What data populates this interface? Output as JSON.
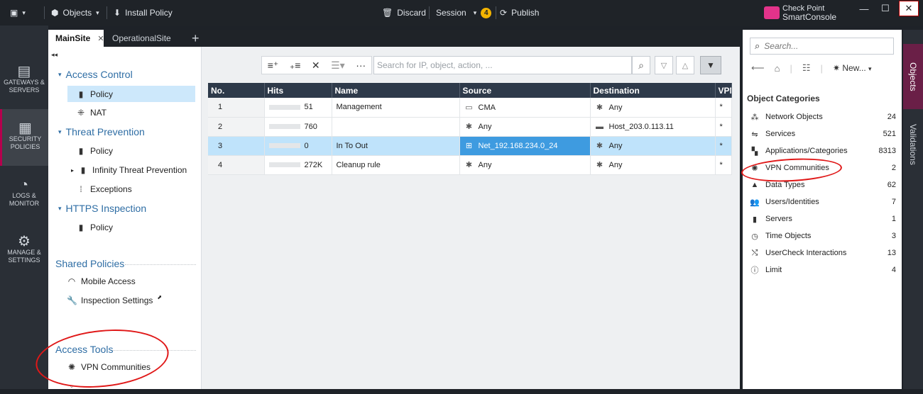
{
  "titlebar": {
    "objects_label": "Objects",
    "install_label": "Install Policy",
    "discard_label": "Discard",
    "session_label": "Session",
    "session_badge": "4",
    "publish_label": "Publish",
    "brand_top": "Check Point",
    "brand_bottom": "SmartConsole"
  },
  "leftnav": [
    {
      "label": "GATEWAYS & SERVERS",
      "icon": "servers-icon"
    },
    {
      "label": "SECURITY POLICIES",
      "icon": "grid-icon"
    },
    {
      "label": "LOGS & MONITOR",
      "icon": "gauge-icon"
    },
    {
      "label": "MANAGE & SETTINGS",
      "icon": "gear-icon"
    }
  ],
  "tabs": [
    {
      "label": "MainSite",
      "active": true
    },
    {
      "label": "OperationalSite",
      "active": false
    }
  ],
  "tree": {
    "access_control": "Access Control",
    "ac_policy": "Policy",
    "ac_nat": "NAT",
    "threat_prevention": "Threat Prevention",
    "tp_policy": "Policy",
    "tp_infinity": "Infinity Threat Prevention",
    "tp_exceptions": "Exceptions",
    "https_inspection": "HTTPS Inspection",
    "https_policy": "Policy",
    "shared_policies": "Shared Policies",
    "mobile_access": "Mobile Access",
    "inspection_settings": "Inspection Settings",
    "access_tools": "Access Tools",
    "vpn_communities": "VPN Communities"
  },
  "search": {
    "placeholder": "Search for IP, object, action, ..."
  },
  "rules": {
    "columns": [
      "No.",
      "Hits",
      "Name",
      "Source",
      "Destination",
      "VPN"
    ],
    "rows": [
      {
        "no": "1",
        "hits": "51",
        "name": "Management",
        "source": "CMA",
        "destination": "Any",
        "vpn": "*"
      },
      {
        "no": "2",
        "hits": "760",
        "name": "",
        "source": "Any",
        "destination": "Host_203.0.113.11",
        "vpn": "*"
      },
      {
        "no": "3",
        "hits": "0",
        "name": "In To Out",
        "source": "Net_192.168.234.0_24",
        "destination": "Any",
        "vpn": "*"
      },
      {
        "no": "4",
        "hits": "272K",
        "name": "Cleanup rule",
        "source": "Any",
        "destination": "Any",
        "vpn": "*"
      }
    ]
  },
  "objects_panel": {
    "search_placeholder": "Search...",
    "new_label": "New...",
    "categories_title": "Object Categories",
    "categories": [
      {
        "name": "Network Objects",
        "count": "24",
        "icon": "network-icon"
      },
      {
        "name": "Services",
        "count": "521",
        "icon": "services-icon"
      },
      {
        "name": "Applications/Categories",
        "count": "8313",
        "icon": "apps-icon"
      },
      {
        "name": "VPN Communities",
        "count": "2",
        "icon": "vpn-icon"
      },
      {
        "name": "Data Types",
        "count": "62",
        "icon": "data-types-icon"
      },
      {
        "name": "Users/Identities",
        "count": "7",
        "icon": "users-icon"
      },
      {
        "name": "Servers",
        "count": "1",
        "icon": "server-icon"
      },
      {
        "name": "Time Objects",
        "count": "3",
        "icon": "clock-icon"
      },
      {
        "name": "UserCheck Interactions",
        "count": "13",
        "icon": "usercheck-icon"
      },
      {
        "name": "Limit",
        "count": "4",
        "icon": "limit-icon"
      }
    ]
  },
  "sidetabs": {
    "objects": "Objects",
    "validations": "Validations"
  },
  "colors": {
    "accent": "#b5004d",
    "header": "#2e3a4a",
    "selection": "#bfe3fb",
    "section": "#2e6da4",
    "annotation": "#e01818"
  }
}
